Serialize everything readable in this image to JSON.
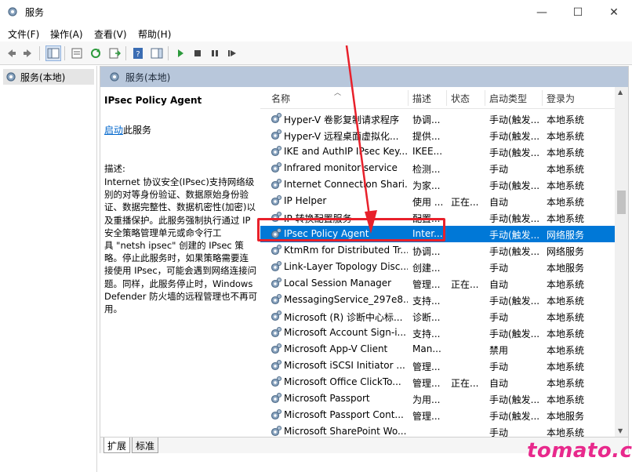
{
  "window": {
    "title": "服务",
    "minimize": "—",
    "maximize": "☐",
    "close": "✕"
  },
  "menu": [
    "文件(F)",
    "操作(A)",
    "查看(V)",
    "帮助(H)"
  ],
  "tree": {
    "root_label": "服务(本地)"
  },
  "content": {
    "header": "服务(本地)"
  },
  "description": {
    "service_name": "IPsec Policy Agent",
    "start_link": "启动",
    "start_suffix": "此服务",
    "label": "描述:",
    "text": "Internet 协议安全(IPsec)支持网络级\n别的对等身份验证、数据原始身份验\n证、数据完整性、数据机密性(加密)以\n及重播保护。此服务强制执行通过 IP\n安全策略管理单元或命令行工\n具 \"netsh ipsec\" 创建的 IPsec 策\n略。停止此服务时，如果策略需要连\n接使用 IPsec，可能会遇到网络连接问\n题。同样，此服务停止时，Windows\nDefender 防火墙的远程管理也不再可\n用。"
  },
  "columns": {
    "name": "名称",
    "desc": "描述",
    "status": "状态",
    "type": "启动类型",
    "logon": "登录为"
  },
  "rows": [
    {
      "name": "Hyper-V 卷影复制请求程序",
      "desc": "协调...",
      "status": "",
      "type": "手动(触发...",
      "logon": "本地系统"
    },
    {
      "name": "Hyper-V 远程桌面虚拟化...",
      "desc": "提供...",
      "status": "",
      "type": "手动(触发...",
      "logon": "本地系统"
    },
    {
      "name": "IKE and AuthIP IPsec Key...",
      "desc": "IKEE...",
      "status": "",
      "type": "手动(触发...",
      "logon": "本地系统"
    },
    {
      "name": "Infrared monitor service",
      "desc": "检测...",
      "status": "",
      "type": "手动",
      "logon": "本地系统"
    },
    {
      "name": "Internet Connection Shari...",
      "desc": "为家...",
      "status": "",
      "type": "手动(触发...",
      "logon": "本地系统"
    },
    {
      "name": "IP Helper",
      "desc": "使用 ...",
      "status": "正在...",
      "type": "自动",
      "logon": "本地系统"
    },
    {
      "name": "IP 转换配置服务",
      "desc": "配置...",
      "status": "",
      "type": "手动(触发...",
      "logon": "本地系统"
    },
    {
      "name": "IPsec Policy Agent",
      "desc": "Inter...",
      "status": "",
      "type": "手动(触发...",
      "logon": "网络服务"
    },
    {
      "name": "KtmRm for Distributed Tr...",
      "desc": "协调...",
      "status": "",
      "type": "手动(触发...",
      "logon": "网络服务"
    },
    {
      "name": "Link-Layer Topology Disc...",
      "desc": "创建...",
      "status": "",
      "type": "手动",
      "logon": "本地服务"
    },
    {
      "name": "Local Session Manager",
      "desc": "管理...",
      "status": "正在...",
      "type": "自动",
      "logon": "本地系统"
    },
    {
      "name": "MessagingService_297e8...",
      "desc": "支持...",
      "status": "",
      "type": "手动(触发...",
      "logon": "本地系统"
    },
    {
      "name": "Microsoft (R) 诊断中心标...",
      "desc": "诊断...",
      "status": "",
      "type": "手动",
      "logon": "本地系统"
    },
    {
      "name": "Microsoft Account Sign-i...",
      "desc": "支持...",
      "status": "",
      "type": "手动(触发...",
      "logon": "本地系统"
    },
    {
      "name": "Microsoft App-V Client",
      "desc": "Man...",
      "status": "",
      "type": "禁用",
      "logon": "本地系统"
    },
    {
      "name": "Microsoft iSCSI Initiator ...",
      "desc": "管理...",
      "status": "",
      "type": "手动",
      "logon": "本地系统"
    },
    {
      "name": "Microsoft Office ClickTo...",
      "desc": "管理...",
      "status": "正在...",
      "type": "自动",
      "logon": "本地系统"
    },
    {
      "name": "Microsoft Passport",
      "desc": "为用...",
      "status": "",
      "type": "手动(触发...",
      "logon": "本地系统"
    },
    {
      "name": "Microsoft Passport Cont...",
      "desc": "管理...",
      "status": "",
      "type": "手动(触发...",
      "logon": "本地服务"
    },
    {
      "name": "Microsoft SharePoint Wo...",
      "desc": "",
      "status": "",
      "type": "手动",
      "logon": "本地系统"
    }
  ],
  "tabs": [
    "扩展",
    "标准"
  ],
  "watermark": "tomato.cm",
  "colors": {
    "selection": "#0078d7",
    "header_band": "#b8c7db",
    "annotation_red": "#e8212b",
    "watermark": "#e8298c"
  }
}
